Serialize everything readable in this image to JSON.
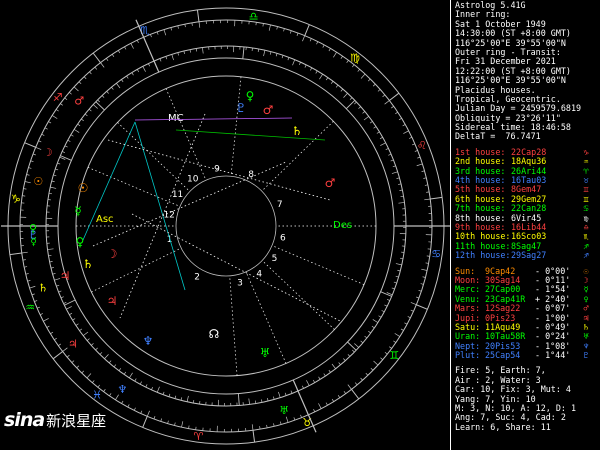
{
  "header": {
    "app_title": "Astrolog 5.41G",
    "inner_ring_label": "Inner ring:",
    "inner_date": "Sat 1 October 1949",
    "inner_time": "14:30:00 (ST +8:00 GMT)",
    "inner_location": "116°25'00\"E 39°55'00\"N",
    "outer_ring_label": "Outer ring - Transit:",
    "outer_date": "Fri 31 December 2021",
    "outer_time": "12:22:00 (ST +8:00 GMT)",
    "outer_location": "116°25'00\"E 39°55'00\"N",
    "house_system": "Placidus houses.",
    "zodiac": "Tropical, Geocentric.",
    "julian_day": "Julian Day = 2459579.6819",
    "obliquity": "Obliquity = 23°26'11\"",
    "sidereal_time": "Sidereal time: 18:46:58",
    "delta_t": "DeltaT =  76.7471"
  },
  "houses": [
    {
      "label": "1st house:",
      "value": "22Cap28",
      "symbol": "♑",
      "color": "#ff4040"
    },
    {
      "label": "2nd house:",
      "value": "18Aqu36",
      "symbol": "♒",
      "color": "#ffff00"
    },
    {
      "label": "3rd house:",
      "value": "26Ari44",
      "symbol": "♈",
      "color": "#00ff00"
    },
    {
      "label": "4th house:",
      "value": "16Tau03",
      "symbol": "♉",
      "color": "#4080ff"
    },
    {
      "label": "5th house:",
      "value": "8Gem47",
      "symbol": "♊",
      "color": "#ff4040"
    },
    {
      "label": "6th house:",
      "value": "29Gem27",
      "symbol": "♊",
      "color": "#ffff00"
    },
    {
      "label": "7th house:",
      "value": "22Can28",
      "symbol": "♋",
      "color": "#00ff00"
    },
    {
      "label": "8th house:",
      "value": "6Vir45",
      "symbol": "♍",
      "color": "#ffffff"
    },
    {
      "label": "9th house:",
      "value": "16Lib44",
      "symbol": "♎",
      "color": "#ff4040"
    },
    {
      "label": "10th house:",
      "value": "16Sco03",
      "symbol": "♏",
      "color": "#ffff00"
    },
    {
      "label": "11th house:",
      "value": "8Sag47",
      "symbol": "♐",
      "color": "#00ff00"
    },
    {
      "label": "12th house:",
      "value": "29Sag27",
      "symbol": "♐",
      "color": "#4080ff"
    }
  ],
  "planets": [
    {
      "label": "Sun:",
      "value": "9Cap42",
      "motion": "- 0°00'",
      "symbol": "☉",
      "color": "#ff8c00"
    },
    {
      "label": "Moon:",
      "value": "30Sag14",
      "motion": "- 0°11'",
      "symbol": "☽",
      "color": "#ff4040"
    },
    {
      "label": "Merc:",
      "value": "27Cap00",
      "motion": "- 1°54'",
      "symbol": "☿",
      "color": "#00ff00"
    },
    {
      "label": "Venu:",
      "value": "23Cap41R",
      "motion": "+ 2°40'",
      "symbol": "♀",
      "color": "#00ff00"
    },
    {
      "label": "Mars:",
      "value": "12Sag22",
      "motion": "- 0°07'",
      "symbol": "♂",
      "color": "#ff4040"
    },
    {
      "label": "Jupi:",
      "value": "0Pis23",
      "motion": "- 1°00'",
      "symbol": "♃",
      "color": "#ff4040"
    },
    {
      "label": "Satu:",
      "value": "11Aqu49",
      "motion": "- 0°49'",
      "symbol": "♄",
      "color": "#ffff00"
    },
    {
      "label": "Uran:",
      "value": "10Tau58R",
      "motion": "- 0°24'",
      "symbol": "♅",
      "color": "#00ff00"
    },
    {
      "label": "Nept:",
      "value": "20Pis53",
      "motion": "- 1°08'",
      "symbol": "♆",
      "color": "#4080ff"
    },
    {
      "label": "Plut:",
      "value": "25Cap54",
      "motion": "- 1°44'",
      "symbol": "♇",
      "color": "#4080ff"
    }
  ],
  "summary": [
    "Fire: 5, Earth: 7,",
    "Air : 2, Water: 3",
    "Car: 10, Fix: 3, Mut: 4",
    "Yang: 7, Yin: 10",
    "M: 3, N: 10, A: 12, D: 1",
    "Ang: 7, Suc: 4, Cad: 2",
    "Learn: 6, Share: 11"
  ],
  "wheel": {
    "angle_labels": [
      "Asc",
      "Des",
      "MC"
    ],
    "house_numbers": [
      "1",
      "2",
      "3",
      "4",
      "5",
      "6",
      "7",
      "8",
      "9",
      "10",
      "11",
      "12"
    ],
    "sign_glyphs": [
      "♈",
      "♉",
      "♊",
      "♋",
      "♌",
      "♍",
      "♎",
      "♏",
      "♐",
      "♑",
      "♒",
      "♓"
    ],
    "colors": {
      "ring": "#c0c0c0",
      "dotted": "#ffffff",
      "aspect_cyan": "#00c8c8",
      "aspect_green": "#00c000",
      "aspect_purple": "#c060ff"
    }
  },
  "watermark": {
    "logo": "sina",
    "text": "新浪星座"
  }
}
